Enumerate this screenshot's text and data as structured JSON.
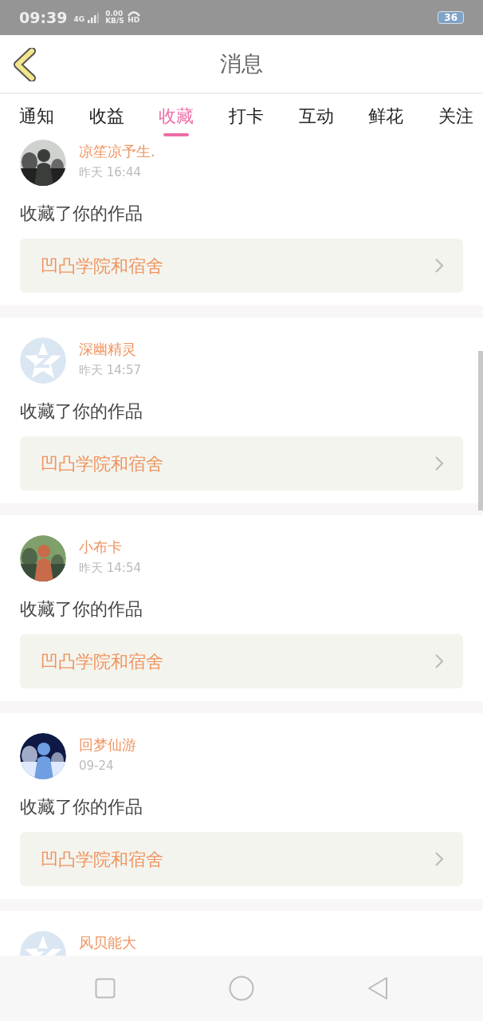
{
  "status_bar": {
    "time": "09:39",
    "network": "4G",
    "speed": "0.00",
    "speed_unit": "KB/S",
    "hd": "HD",
    "battery": "36"
  },
  "header": {
    "title": "消息"
  },
  "tabs": [
    {
      "label": "通知",
      "selected": false
    },
    {
      "label": "收益",
      "selected": false
    },
    {
      "label": "收藏",
      "selected": true
    },
    {
      "label": "打卡",
      "selected": false
    },
    {
      "label": "互动",
      "selected": false
    },
    {
      "label": "鲜花",
      "selected": false
    },
    {
      "label": "关注",
      "selected": false
    }
  ],
  "messages": [
    {
      "user": "凉笙凉予生.",
      "time": "昨天 16:44",
      "text": "收藏了你的作品",
      "work": "凹凸学院和宿舍"
    },
    {
      "user": "深幽精灵",
      "avatar": {
        "kind": "default"
      },
      "time": "昨天 14:57",
      "text": "收藏了你的作品",
      "work": "凹凸学院和宿舍"
    },
    {
      "user": "小布卡",
      "time": "昨天 14:54",
      "text": "收藏了你的作品",
      "work": "凹凸学院和宿舍"
    },
    {
      "user": "回梦仙游",
      "time": "09-24",
      "text": "收藏了你的作品",
      "work": "凹凸学院和宿舍"
    },
    {
      "user": "风贝能大",
      "avatar": {
        "kind": "default"
      }
    }
  ]
}
